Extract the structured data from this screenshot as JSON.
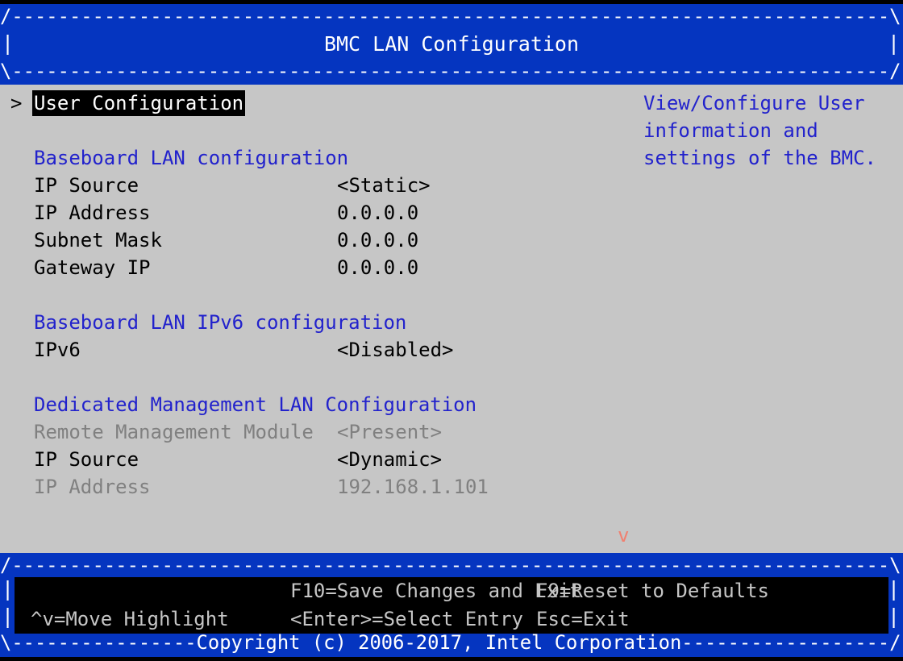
{
  "window": {
    "title": "BMC LAN Configuration",
    "border_top": "/----------------------------------------------------------------------------\\",
    "border_bottom": "\\----------------------------------------------------------------------------/",
    "edge_left": "|",
    "edge_right": "|"
  },
  "colors": {
    "frame_blue": "#0535c0",
    "section_blue": "#2222cc",
    "screen_bg": "#c6c6c6",
    "text": "#000000",
    "dim_text": "#808080",
    "highlight_bg": "#000000",
    "highlight_fg": "#ffffff",
    "scroll_arrow": "#f08070"
  },
  "menu": {
    "rows": [
      {
        "caret": ">",
        "label": "User Configuration",
        "value": "",
        "kind": "selected",
        "name": "menu-item-user-configuration"
      },
      {
        "caret": "",
        "label": "",
        "value": "",
        "kind": "blank",
        "name": "menu-spacer"
      },
      {
        "caret": "",
        "label": "Baseboard LAN configuration",
        "value": "",
        "kind": "section",
        "name": "section-baseboard-lan"
      },
      {
        "caret": "",
        "label": "IP Source",
        "value": "<Static>",
        "kind": "option",
        "name": "field-baseboard-ip-source"
      },
      {
        "caret": "",
        "label": "IP Address",
        "value": "0.0.0.0",
        "kind": "option",
        "name": "field-baseboard-ip-address"
      },
      {
        "caret": "",
        "label": "Subnet Mask",
        "value": "0.0.0.0",
        "kind": "option",
        "name": "field-baseboard-subnet-mask"
      },
      {
        "caret": "",
        "label": "Gateway IP",
        "value": "0.0.0.0",
        "kind": "option",
        "name": "field-baseboard-gateway-ip"
      },
      {
        "caret": "",
        "label": "",
        "value": "",
        "kind": "blank",
        "name": "menu-spacer"
      },
      {
        "caret": "",
        "label": "Baseboard LAN IPv6 configuration",
        "value": "",
        "kind": "section",
        "name": "section-baseboard-lan-ipv6"
      },
      {
        "caret": "",
        "label": "IPv6",
        "value": "<Disabled>",
        "kind": "option",
        "name": "field-ipv6"
      },
      {
        "caret": "",
        "label": "",
        "value": "",
        "kind": "blank",
        "name": "menu-spacer"
      },
      {
        "caret": "",
        "label": "Dedicated Management LAN Configuration",
        "value": "",
        "kind": "section",
        "name": "section-dedicated-management-lan"
      },
      {
        "caret": "",
        "label": "Remote Management Module",
        "value": "<Present>",
        "kind": "dim",
        "name": "field-remote-management-module"
      },
      {
        "caret": "",
        "label": "IP Source",
        "value": "<Dynamic>",
        "kind": "option",
        "name": "field-dedicated-ip-source"
      },
      {
        "caret": "",
        "label": "IP Address",
        "value": "192.168.1.101",
        "kind": "dim",
        "name": "field-dedicated-ip-address"
      }
    ]
  },
  "help": {
    "lines": [
      "View/Configure User",
      "information and",
      "settings of the BMC."
    ]
  },
  "scroll": {
    "down_indicator": "v"
  },
  "footer": {
    "border_top": "/----------------------------------------------------------------------------\\",
    "edge_left": "|",
    "edge_right": "|",
    "row1": {
      "left": "",
      "mid": "F10=Save Changes and Exit",
      "right": "F9=Reset to Defaults"
    },
    "row2": {
      "left": "^v=Move Highlight",
      "mid": "<Enter>=Select Entry",
      "right": "Esc=Exit"
    },
    "copyright_line": "\\----------------Copyright (c) 2006-2017, Intel Corporation------------------/",
    "copyright_text": "Copyright (c) 2006-2017, Intel Corporation"
  }
}
